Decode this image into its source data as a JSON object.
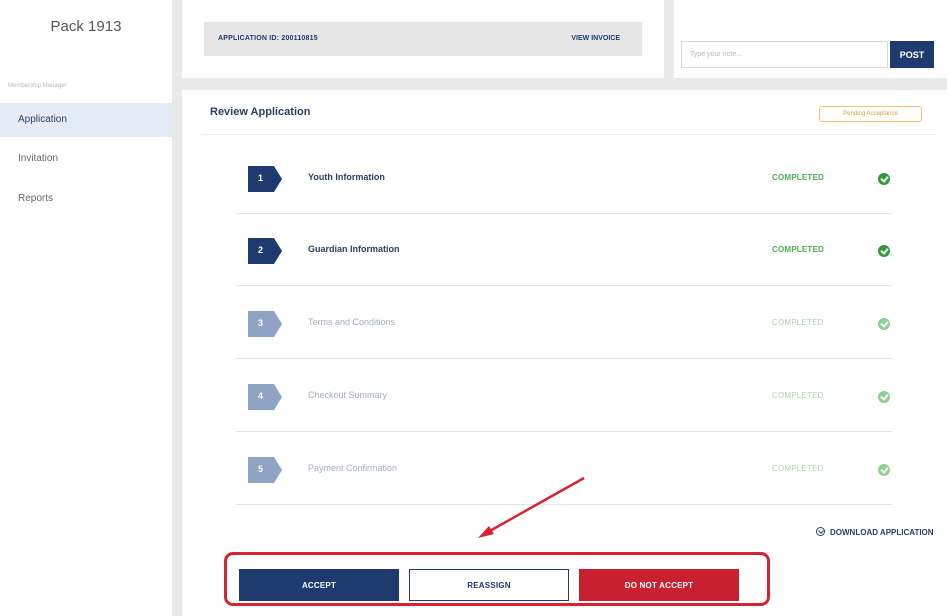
{
  "sidebar": {
    "brand": "Pack 1913",
    "section_label": "Membership Manager",
    "items": [
      {
        "label": "Application",
        "active": true
      },
      {
        "label": "Invitation",
        "active": false
      },
      {
        "label": "Reports",
        "active": false
      }
    ]
  },
  "application_card": {
    "id_label": "APPLICATION ID: 200110815",
    "invoice_link": "VIEW INVOICE"
  },
  "note_card": {
    "placeholder": "Type your note...",
    "post_label": "POST"
  },
  "review": {
    "title": "Review Application",
    "badge": "Pending Acceptance",
    "steps": [
      {
        "number": "1",
        "label": "Youth Information",
        "status": "COMPLETED"
      },
      {
        "number": "2",
        "label": "Guardian Information",
        "status": "COMPLETED"
      },
      {
        "number": "3",
        "label": "Terms and Conditions",
        "status": "COMPLETED"
      },
      {
        "number": "4",
        "label": "Checkout Summary",
        "status": "COMPLETED"
      },
      {
        "number": "5",
        "label": "Payment Confirmation",
        "status": "COMPLETED"
      }
    ],
    "download_label": "DOWNLOAD APPLICATION",
    "actions": {
      "accept": "ACCEPT",
      "reassign": "REASSIGN",
      "reject": "DO NOT ACCEPT"
    }
  },
  "colors": {
    "primary": "#1f3a6e",
    "reject": "#c8202f",
    "success": "#2e9a3a",
    "highlight": "#d62232",
    "badge": "#f2c46f"
  },
  "icons": {
    "check": "check-circle-icon",
    "download": "download-icon",
    "arrow": "annotation-arrow"
  }
}
